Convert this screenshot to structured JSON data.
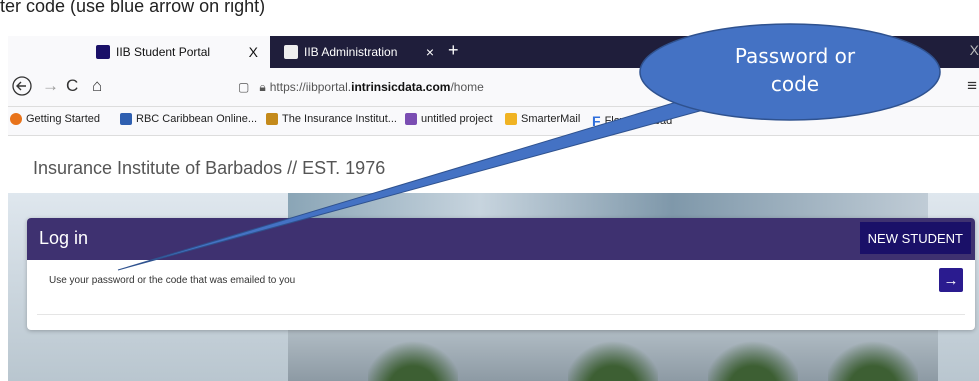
{
  "caption": "ter code (use blue arrow on right)",
  "browser": {
    "tabs": [
      {
        "label": "IIB Student Portal",
        "close": "X",
        "active": true
      },
      {
        "label": "IIB Administration",
        "close": "×",
        "active": false
      }
    ],
    "new_tab": "+",
    "window_close": "X",
    "url_prefix": "https://iibportal.",
    "url_domain": "intrinsicdata.com",
    "url_path": "/home",
    "bookmarks": [
      {
        "label": "Getting Started",
        "color": "#e8731a"
      },
      {
        "label": "RBC Caribbean Online...",
        "color": "#2f5fb0"
      },
      {
        "label": "The Insurance Institut...",
        "color": "#c48a1b"
      },
      {
        "label": "untitled project",
        "color": "#7a4db2"
      },
      {
        "label": "SmarterMail",
        "color": "#f0b323"
      },
      {
        "label": "Flow | Barbad",
        "color": "#2f6fdc"
      }
    ]
  },
  "site": {
    "title": "Insurance Institute of Barbados // EST. 1976"
  },
  "login": {
    "title": "Log in",
    "new_student": "NEW STUDENT",
    "hint": "Use your password or the code that was emailed to you",
    "go": "→",
    "header_color": "#3e3170"
  },
  "callout": {
    "line1": "Password or",
    "line2": "code",
    "color": "#4472c4"
  }
}
